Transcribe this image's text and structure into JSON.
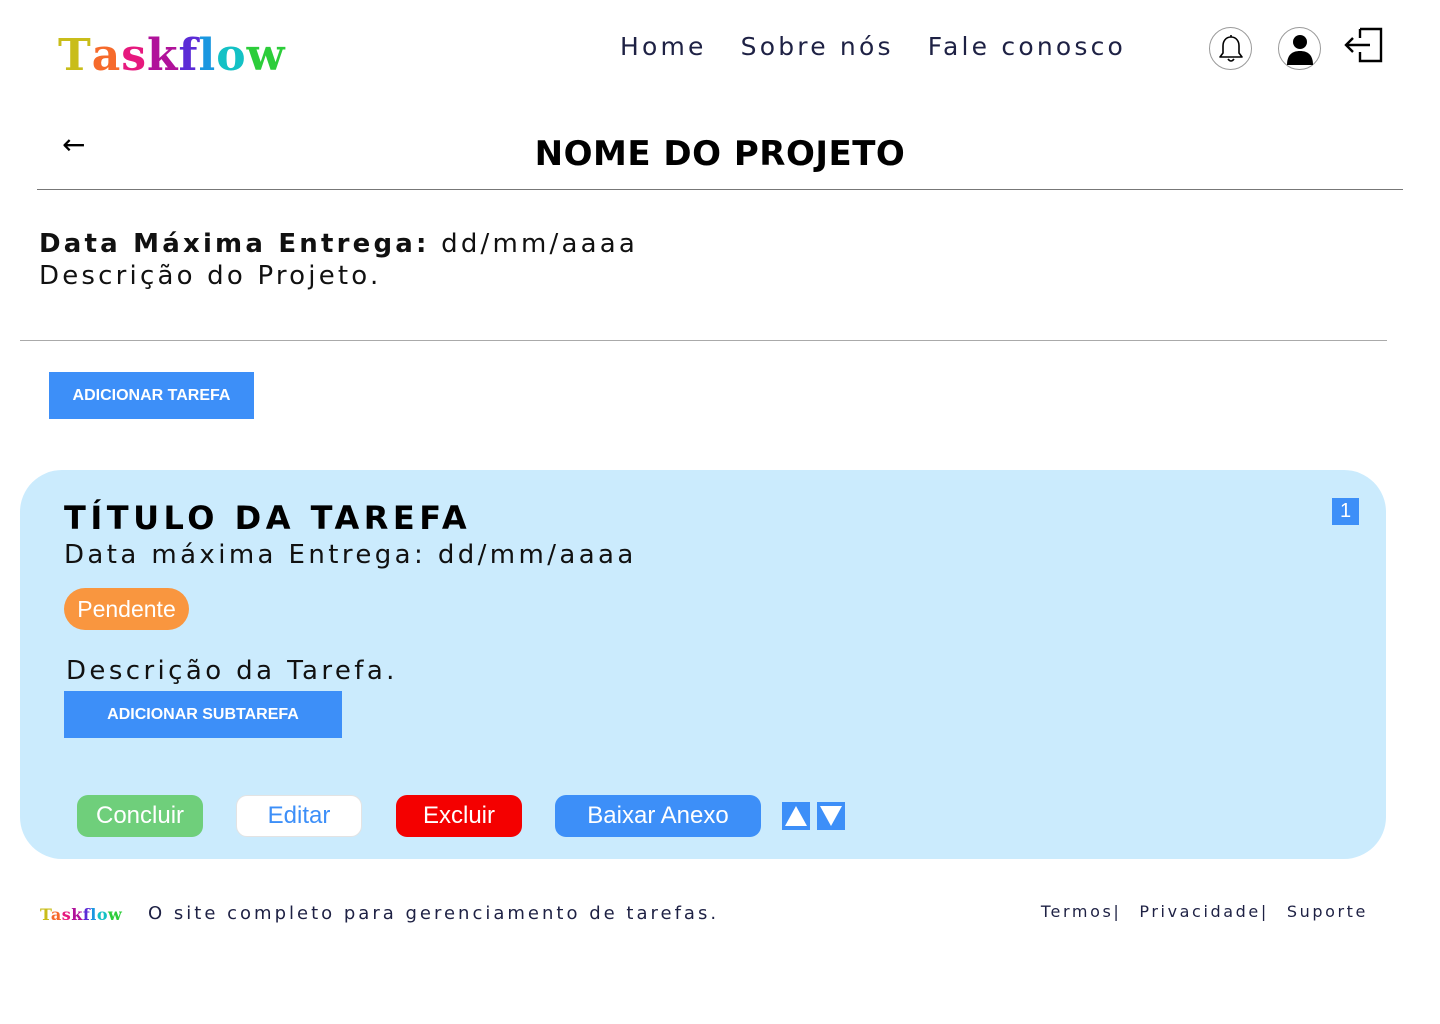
{
  "header": {
    "logo": {
      "letters": [
        "T",
        "a",
        "s",
        "k",
        "f",
        "l",
        "o",
        "w"
      ],
      "colors": [
        "#c9bd1a",
        "#f66a2b",
        "#e6197e",
        "#b0129a",
        "#5b2bd6",
        "#1a97e0",
        "#14c1c5",
        "#2ccd3a"
      ]
    },
    "nav": [
      {
        "label": "Home"
      },
      {
        "label": "Sobre nós"
      },
      {
        "label": "Fale conosco"
      }
    ],
    "icons": {
      "notifications": "bell-icon",
      "profile": "user-icon",
      "logout": "logout-icon"
    }
  },
  "project": {
    "back": "←",
    "title": "NOME DO PROJETO",
    "due_label": "Data Máxima Entrega:",
    "due_value": "dd/mm/aaaa",
    "description": "Descrição do Projeto."
  },
  "toolbar": {
    "add_task_label": "ADICIONAR TAREFA"
  },
  "task": {
    "title": "TÍTULO DA TAREFA",
    "due": "Data máxima Entrega: dd/mm/aaaa",
    "index": "1",
    "status": "Pendente",
    "description": "Descrição da Tarefa.",
    "add_subtask_label": "ADICIONAR SUBTAREFA",
    "actions": {
      "conclude": "Concluir",
      "edit": "Editar",
      "delete": "Excluir",
      "download": "Baixar Anexo"
    }
  },
  "footer": {
    "logo_text": "Taskflow",
    "tagline": "O site completo para gerenciamento de tarefas.",
    "links": [
      "Termos|",
      "Privacidade|",
      "Suporte"
    ]
  },
  "colors": {
    "accent": "#3d8ff8",
    "card_bg": "#cbebfd",
    "pending": "#f9963f",
    "success": "#6fcf7b",
    "danger": "#f40000"
  }
}
